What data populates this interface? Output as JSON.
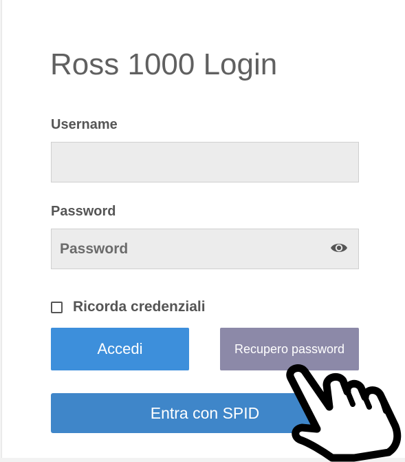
{
  "login": {
    "title": "Ross 1000 Login",
    "username_label": "Username",
    "username_value": "",
    "password_label": "Password",
    "password_placeholder": "Password",
    "remember_label": "Ricorda credenziali",
    "remember_checked": false,
    "login_button": "Accedi",
    "recover_button": "Recupero password",
    "spid_button": "Entra con SPID"
  },
  "icons": {
    "password_toggle": "eye-icon",
    "cursor": "pointing-hand-cursor-icon"
  },
  "colors": {
    "login_button": "#3d8fdb",
    "recover_button": "#8c89a8",
    "spid_button": "#3f86c9",
    "input_background": "#ececec"
  }
}
